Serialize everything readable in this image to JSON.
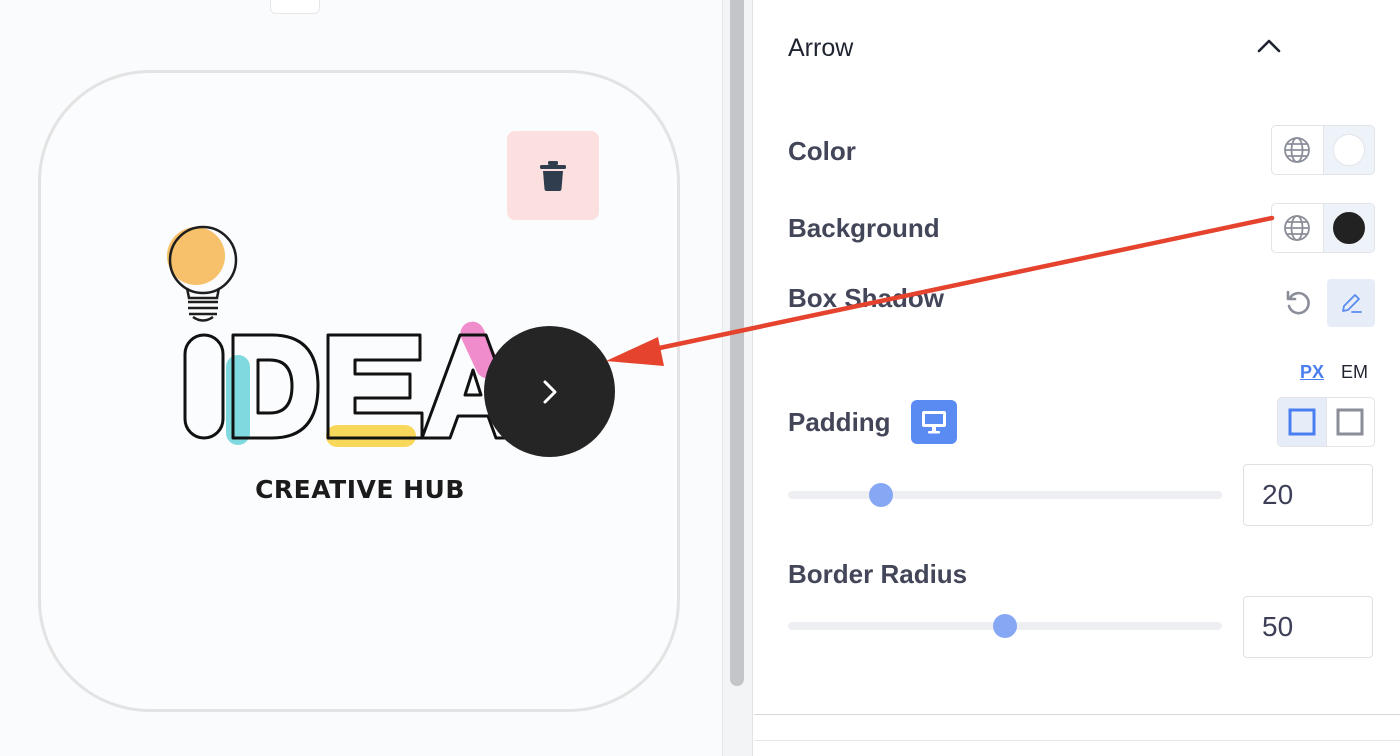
{
  "preview": {
    "logo": {
      "word": "IDEA",
      "caption": "CREATIVE HUB"
    },
    "icons": {
      "delete": "trash-icon",
      "arrow": "chevron-right-icon"
    }
  },
  "panel": {
    "section_title": "Arrow",
    "section_toggle_icon": "chevron-up-icon",
    "color": {
      "label": "Color",
      "global_icon": "globe-icon",
      "swatch": "#ffffff"
    },
    "background": {
      "label": "Background",
      "global_icon": "globe-icon",
      "swatch": "#222222"
    },
    "box_shadow": {
      "label": "Box Shadow",
      "reset_icon": "reset-icon",
      "edit_icon": "pencil-icon"
    },
    "units": {
      "px": "PX",
      "em": "EM",
      "selected": "PX"
    },
    "padding": {
      "label": "Padding",
      "device_icon": "desktop-icon",
      "linked_icon": "square-linked-icon",
      "unlinked_icon": "square-unlinked-icon",
      "value": "20",
      "slider_fraction": 0.215
    },
    "border_radius": {
      "label": "Border Radius",
      "value": "50",
      "slider_fraction": 0.5
    }
  },
  "colors": {
    "accent": "#5a8bf2",
    "annotation_arrow": "#e5432e",
    "delete_bg": "#fbe0df"
  }
}
